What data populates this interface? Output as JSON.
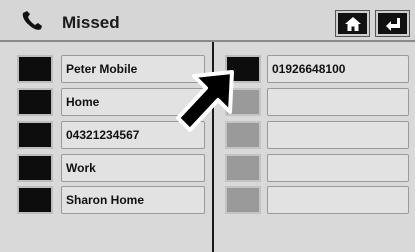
{
  "header": {
    "title": "Missed",
    "phone_icon": "phone-handset-icon",
    "home_icon": "home-icon",
    "back_icon": "back-arrow-icon"
  },
  "left_list": [
    {
      "label": "Peter Mobile"
    },
    {
      "label": "Home"
    },
    {
      "label": "04321234567"
    },
    {
      "label": "Work"
    },
    {
      "label": "Sharon Home"
    }
  ],
  "right_list": [
    {
      "label": "01926648100"
    },
    {
      "label": ""
    },
    {
      "label": ""
    },
    {
      "label": ""
    },
    {
      "label": ""
    }
  ],
  "overlay": {
    "pointer_icon": "pointer-arrow-icon"
  }
}
